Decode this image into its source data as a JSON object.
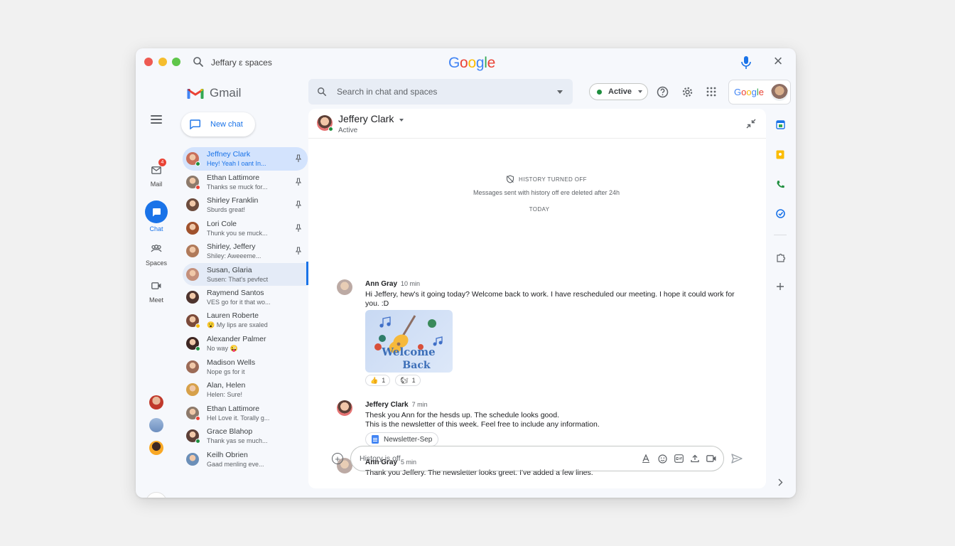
{
  "titlebar": {
    "search_query": "Jeffary ε spaces",
    "brand": [
      "G",
      "o",
      "o",
      "g",
      "l",
      "e"
    ]
  },
  "rail": {
    "items": [
      {
        "label": "Mail",
        "badge": "4"
      },
      {
        "label": "Chat"
      },
      {
        "label": "Spaces"
      },
      {
        "label": "Meet"
      }
    ]
  },
  "sidebar": {
    "app_name": "Gmail",
    "new_chat_label": "New chat",
    "conversations": [
      {
        "name": "Jeffney Clark",
        "preview": "Hey! Yeah I oant In...",
        "pinned": true,
        "active": true,
        "color": "#c96f5a"
      },
      {
        "name": "Ethan Lattimore",
        "preview": "Thanks se muck for...",
        "pinned": true,
        "color": "#8d7a6b"
      },
      {
        "name": "Shirley Franklin",
        "preview": "Sburds great!",
        "pinned": true,
        "color": "#6d4c3d"
      },
      {
        "name": "Lori Cole",
        "preview": "Thunk you se muck...",
        "pinned": true,
        "color": "#a0522d"
      },
      {
        "name": "Shirley, Jeffery",
        "preview": "Shiley: Aweeeme...",
        "pinned": true,
        "color": "#b07a5a"
      },
      {
        "name": "Susan, Glaria",
        "preview": "Susen: That's pevfect",
        "selected": true,
        "color": "#c48f7a"
      },
      {
        "name": "Raymend Santos",
        "preview": "VES go for it that wo...",
        "color": "#4e342e"
      },
      {
        "name": "Lauren Roberte",
        "preview": "😮 My lips are sxaled",
        "color": "#7b4a3a"
      },
      {
        "name": "Alexander Palmer",
        "preview": "No way 😜",
        "color": "#3e2723"
      },
      {
        "name": "Madison Wells",
        "preview": "Nope gs for it",
        "color": "#9c6b57"
      },
      {
        "name": "Alan, Helen",
        "preview": "Helen: Sure!",
        "color": "#d7a14a"
      },
      {
        "name": "Ethan Lattimore",
        "preview": "Hel Love it. Torally g...",
        "color": "#8d7a6b"
      },
      {
        "name": "Grace Blahop",
        "preview": "Thank yas se much...",
        "color": "#5d4037"
      },
      {
        "name": "Keilh Obrien",
        "preview": "Gaad menling eve...",
        "color": "#6b8fb8"
      }
    ]
  },
  "top": {
    "search_placeholder": "Search in chat and spaces",
    "status": "Active",
    "account_brand": [
      "G",
      "o",
      "o",
      "g",
      "l",
      "e"
    ]
  },
  "chat": {
    "contact_name": "Jeffery Clark",
    "contact_status": "Active",
    "history_title": "HISTORY TURNED OFF",
    "history_note": "Messages sent with history off ere deleted after 24h",
    "day_label": "TODAY",
    "messages": [
      {
        "author": "Ann Gray",
        "time": "10 min",
        "text": "Hi Jeffery, hew's it going today? Welcome back to work. I have rescheduled our meeting. I hope it could work for you. :D",
        "image_text": [
          "Welcome",
          "Back"
        ],
        "reactions": [
          {
            "emoji": "👍",
            "count": "1"
          },
          {
            "emoji": "🐿",
            "count": "1"
          }
        ]
      },
      {
        "author": "Jeffery Clark",
        "time": "7 min",
        "text_lines": [
          "Thesk you Ann for the hesds up. The schedule looks good.",
          "This is the newsletter of this week. Feel free to include any information."
        ],
        "attachment": "Newsletter-Sep"
      },
      {
        "author": "Ann Gray",
        "time": "5 min",
        "text": "Thank you Jeffery. The newsletter looks greet. I've added a few lines."
      }
    ],
    "composer_placeholder": "History is off"
  },
  "colors": {
    "accent": "#1a73e8",
    "online": "#1e8e3e",
    "active_row": "#d3e3fd"
  }
}
